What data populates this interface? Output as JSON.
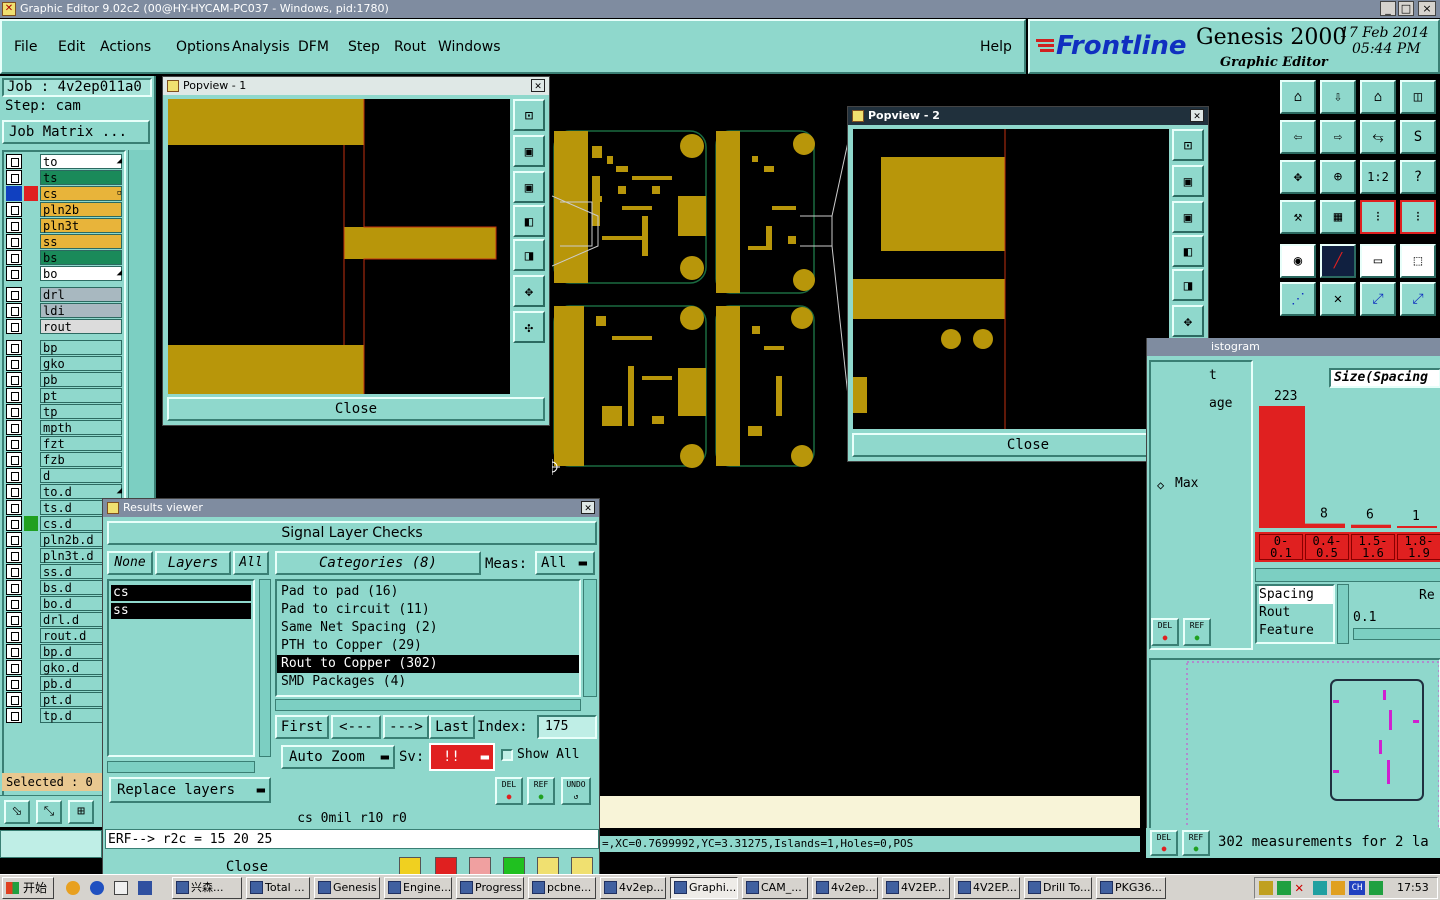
{
  "window": {
    "title": "Graphic Editor 9.02c2 (00@HY-HYCAM-PC037 - Windows, pid:1780)",
    "min": "_",
    "max": "□",
    "close": "×"
  },
  "menu": {
    "items": [
      "File",
      "Edit",
      "Actions",
      "Options",
      "Analysis",
      "DFM",
      "Step",
      "Rout",
      "Windows"
    ],
    "help": "Help"
  },
  "brand": {
    "logo": "Frontline",
    "product": "Genesis 2000",
    "subtitle": "Graphic Editor",
    "date": "17 Feb 2014",
    "time": "05:44 PM"
  },
  "job": {
    "job_label": "Job : 4v2ep011a0",
    "step_label": "Step: cam",
    "matrix_btn": "Job Matrix ..."
  },
  "layers": [
    {
      "name": "to",
      "bg": "#ffffff",
      "mark": "◢"
    },
    {
      "name": "ts",
      "bg": "#1a8a5a"
    },
    {
      "name": "cs",
      "bg": "#e8b43a",
      "mark": "▫"
    },
    {
      "name": "pln2b",
      "bg": "#e8b43a"
    },
    {
      "name": "pln3t",
      "bg": "#e8b43a"
    },
    {
      "name": "ss",
      "bg": "#e8b43a"
    },
    {
      "name": "bs",
      "bg": "#1a8a5a"
    },
    {
      "name": "bo",
      "bg": "#ffffff",
      "mark": "◢"
    },
    {
      "name": "drl",
      "bg": "#a8b8c0"
    },
    {
      "name": "ldi",
      "bg": "#a8b8c0"
    },
    {
      "name": "rout",
      "bg": "#dcdcdc"
    },
    {
      "name": "bp",
      "bg": "#8fd8cc"
    },
    {
      "name": "gko",
      "bg": "#8fd8cc"
    },
    {
      "name": "pb",
      "bg": "#8fd8cc"
    },
    {
      "name": "pt",
      "bg": "#8fd8cc"
    },
    {
      "name": "tp",
      "bg": "#8fd8cc"
    },
    {
      "name": "mpth",
      "bg": "#8fd8cc"
    },
    {
      "name": "fzt",
      "bg": "#8fd8cc"
    },
    {
      "name": "fzb",
      "bg": "#8fd8cc"
    },
    {
      "name": "d",
      "bg": "#8fd8cc"
    },
    {
      "name": "to.d",
      "bg": "#8fd8cc",
      "mark": "◢"
    },
    {
      "name": "ts.d",
      "bg": "#8fd8cc"
    },
    {
      "name": "cs.d",
      "bg": "#8fd8cc"
    },
    {
      "name": "pln2b.d",
      "bg": "#8fd8cc"
    },
    {
      "name": "pln3t.d",
      "bg": "#8fd8cc"
    },
    {
      "name": "ss.d",
      "bg": "#8fd8cc"
    },
    {
      "name": "bs.d",
      "bg": "#8fd8cc"
    },
    {
      "name": "bo.d",
      "bg": "#8fd8cc"
    },
    {
      "name": "drl.d",
      "bg": "#8fd8cc"
    },
    {
      "name": "rout.d",
      "bg": "#8fd8cc"
    },
    {
      "name": "bp.d",
      "bg": "#8fd8cc"
    },
    {
      "name": "gko.d",
      "bg": "#8fd8cc"
    },
    {
      "name": "pb.d",
      "bg": "#8fd8cc"
    },
    {
      "name": "pt.d",
      "bg": "#8fd8cc"
    },
    {
      "name": "tp.d",
      "bg": "#8fd8cc"
    }
  ],
  "selected": "Selected : 0",
  "popview1": {
    "title": "Popview - 1",
    "close": "Close"
  },
  "popview2": {
    "title": "Popview - 2",
    "close": "Close"
  },
  "results": {
    "title": "Results viewer",
    "header": "Signal Layer Checks",
    "none": "None",
    "layers_label": "Layers",
    "all": "All",
    "categories_label": "Categories (8)",
    "meas_label": "Meas:",
    "meas_value": "All",
    "layer_list": [
      "cs",
      "ss"
    ],
    "categories": [
      "Pad to pad (16)",
      "Pad to circuit (11)",
      "Same Net Spacing (2)",
      "PTH to Copper (29)",
      "Rout to Copper (302)",
      "SMD Packages (4)"
    ],
    "first": "First",
    "prev": "<---",
    "next": "--->",
    "last": "Last",
    "index_label": "Index:",
    "index_value": "175",
    "auto_zoom": "Auto Zoom",
    "sv_label": "Sv:",
    "sv_value": "!!",
    "show_all": "Show All",
    "replace_layers": "Replace layers",
    "del": "DEL",
    "ref": "REF",
    "undo": "UNDO",
    "status": "cs 0mil  r10  r0",
    "erf": "ERF--> r2c = 15 20 25",
    "close": "Close"
  },
  "histogram": {
    "title": "istogram",
    "left_labels": [
      "t",
      "age"
    ],
    "max_label": "Max",
    "dropdown": "Size(Spacing",
    "bars": [
      {
        "label": "0-\n0.1",
        "value": 223
      },
      {
        "label": "0.4-\n0.5",
        "value": 8
      },
      {
        "label": "1.5-\n1.6",
        "value": 6
      },
      {
        "label": "1.8-\n1.9",
        "value": 1
      }
    ],
    "list": [
      "Spacing",
      "Rout",
      "Feature"
    ],
    "re": "Re",
    "slider_value": "0.1",
    "del": "DEL",
    "ref": "REF"
  },
  "measurements": "302 measurements for 2 la",
  "coords": "=,XC=0.7699992,YC=3.31275,Islands=1,Holes=0,POS",
  "taskbar": {
    "start": "开始",
    "tasks": [
      "兴森...",
      "Total ...",
      "Genesis",
      "Engine...",
      "Progress",
      "pcbne...",
      "4v2ep...",
      "Graphi...",
      "CAM_...",
      "4v2ep...",
      "4V2EP...",
      "4V2EP...",
      "Drill To...",
      "PKG36..."
    ],
    "clock": "17:53"
  },
  "colors": {
    "teal": "#8fd8cc",
    "copper": "#b8960a",
    "accent_red": "#e02020"
  }
}
